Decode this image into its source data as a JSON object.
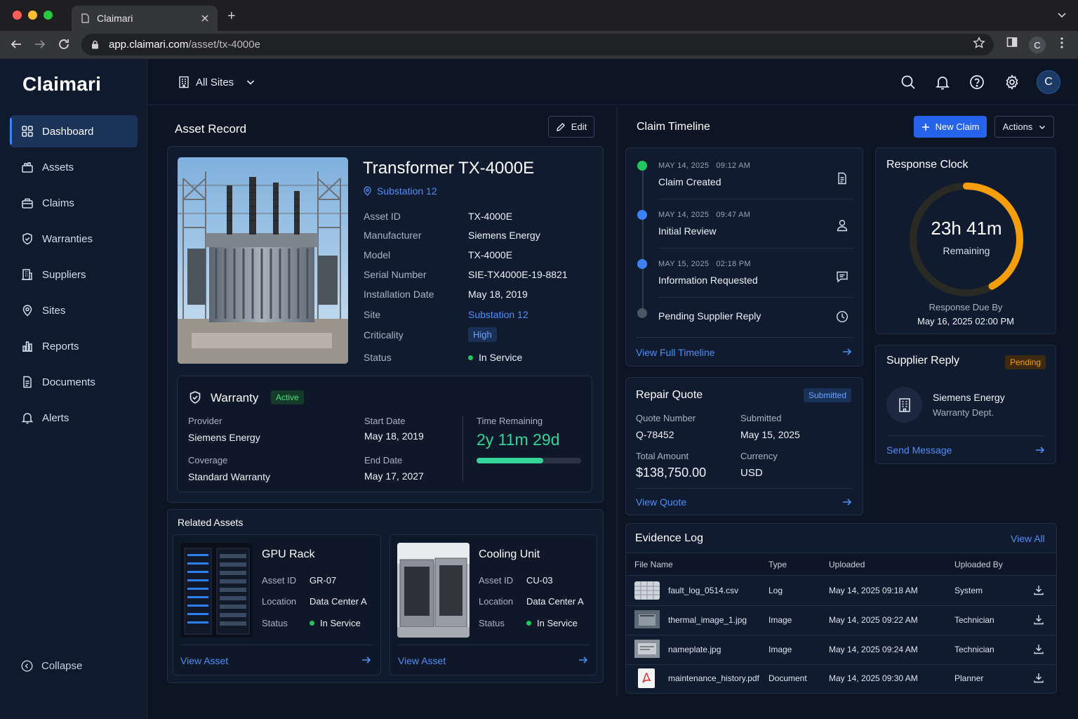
{
  "browser": {
    "tab_title": "Claimari",
    "url_host": "app.claimari.com",
    "url_path": "/asset/tx-4000e",
    "profile_initial": "C"
  },
  "sidebar": {
    "logo": "Claimari",
    "items": [
      {
        "label": "Dashboard",
        "icon": "grid-icon",
        "active": true
      },
      {
        "label": "Assets",
        "icon": "box-icon"
      },
      {
        "label": "Claims",
        "icon": "briefcase-icon"
      },
      {
        "label": "Warranties",
        "icon": "shield-icon"
      },
      {
        "label": "Suppliers",
        "icon": "building-icon"
      },
      {
        "label": "Sites",
        "icon": "map-pin-icon"
      },
      {
        "label": "Reports",
        "icon": "bar-chart-icon"
      },
      {
        "label": "Documents",
        "icon": "document-icon"
      },
      {
        "label": "Alerts",
        "icon": "bell-icon"
      }
    ],
    "collapse_label": "Collapse"
  },
  "topbar": {
    "site_selector": "All Sites",
    "avatar_initial": "C"
  },
  "asset_record": {
    "section_title": "Asset Record",
    "edit_label": "Edit",
    "name": "Transformer TX-4000E",
    "location": "Substation 12",
    "fields": {
      "asset_id_label": "Asset ID",
      "asset_id": "TX-4000E",
      "manufacturer_label": "Manufacturer",
      "manufacturer": "Siemens Energy",
      "model_label": "Model",
      "model": "TX-4000E",
      "serial_label": "Serial Number",
      "serial": "SIE-TX4000E-19-8821",
      "install_label": "Installation Date",
      "install": "May 18, 2019",
      "site_label": "Site",
      "site": "Substation 12",
      "criticality_label": "Criticality",
      "criticality": "High",
      "status_label": "Status",
      "status": "In Service"
    },
    "warranty": {
      "title": "Warranty",
      "badge": "Active",
      "provider_label": "Provider",
      "provider": "Siemens Energy",
      "coverage_label": "Coverage",
      "coverage": "Standard Warranty",
      "start_label": "Start Date",
      "start": "May 18, 2019",
      "end_label": "End Date",
      "end": "May 17, 2027",
      "remaining_label": "Time Remaining",
      "remaining": "2y 11m 29d",
      "remaining_fraction": 0.64
    }
  },
  "related_assets": {
    "title": "Related Assets",
    "items": [
      {
        "name": "GPU Rack",
        "asset_id_label": "Asset ID",
        "asset_id": "GR-07",
        "location_label": "Location",
        "location": "Data Center A",
        "status_label": "Status",
        "status": "In Service",
        "link": "View Asset"
      },
      {
        "name": "Cooling Unit",
        "asset_id_label": "Asset ID",
        "asset_id": "CU-03",
        "location_label": "Location",
        "location": "Data Center A",
        "status_label": "Status",
        "status": "In Service",
        "link": "View Asset"
      }
    ]
  },
  "claim_timeline": {
    "title": "Claim Timeline",
    "new_claim": "New Claim",
    "actions": "Actions",
    "events": [
      {
        "date": "MAY 14, 2025",
        "time": "09:12 AM",
        "title": "Claim Created",
        "icon": "document-icon",
        "color": "#22c55e"
      },
      {
        "date": "MAY 14, 2025",
        "time": "09:47 AM",
        "title": "Initial Review",
        "icon": "user-icon",
        "color": "#3b82f6"
      },
      {
        "date": "MAY 15, 2025",
        "time": "02:18 PM",
        "title": "Information Requested",
        "icon": "message-icon",
        "color": "#3b82f6"
      },
      {
        "date": "",
        "time": "",
        "title": "Pending Supplier Reply",
        "icon": "clock-icon",
        "color": "#6b7280"
      }
    ],
    "view_full": "View Full Timeline"
  },
  "response_clock": {
    "title": "Response Clock",
    "value": "23h 41m",
    "caption": "Remaining",
    "due_label": "Response Due By",
    "due": "May 16, 2025 02:00 PM",
    "fraction_remaining": 0.42
  },
  "repair_quote": {
    "title": "Repair Quote",
    "badge": "Submitted",
    "quote_label": "Quote Number",
    "quote": "Q-78452",
    "submitted_label": "Submitted",
    "submitted": "May 15, 2025",
    "total_label": "Total Amount",
    "total": "$138,750.00",
    "currency_label": "Currency",
    "currency": "USD",
    "link": "View Quote"
  },
  "supplier_reply": {
    "title": "Supplier Reply",
    "badge": "Pending",
    "supplier": "Siemens Energy",
    "dept": "Warranty Dept.",
    "link": "Send Message"
  },
  "evidence_log": {
    "title": "Evidence Log",
    "view_all": "View All",
    "columns": [
      "File Name",
      "Type",
      "Uploaded",
      "Uploaded By"
    ],
    "rows": [
      {
        "file": "fault_log_0514.csv",
        "type": "Log",
        "uploaded": "May 14, 2025 09:18 AM",
        "by": "System",
        "icon": "spreadsheet-icon"
      },
      {
        "file": "thermal_image_1.jpg",
        "type": "Image",
        "uploaded": "May 14, 2025 09:22 AM",
        "by": "Technician",
        "icon": "image-icon"
      },
      {
        "file": "nameplate.jpg",
        "type": "Image",
        "uploaded": "May 14, 2025 09:24 AM",
        "by": "Technician",
        "icon": "image-icon"
      },
      {
        "file": "maintenance_history.pdf",
        "type": "Document",
        "uploaded": "May 14, 2025 09:30 AM",
        "by": "Planner",
        "icon": "pdf-icon"
      }
    ]
  },
  "colors": {
    "accent": "#3b82f6",
    "success": "#22c55e",
    "warning": "#f59e0b",
    "background": "#0d1424"
  }
}
